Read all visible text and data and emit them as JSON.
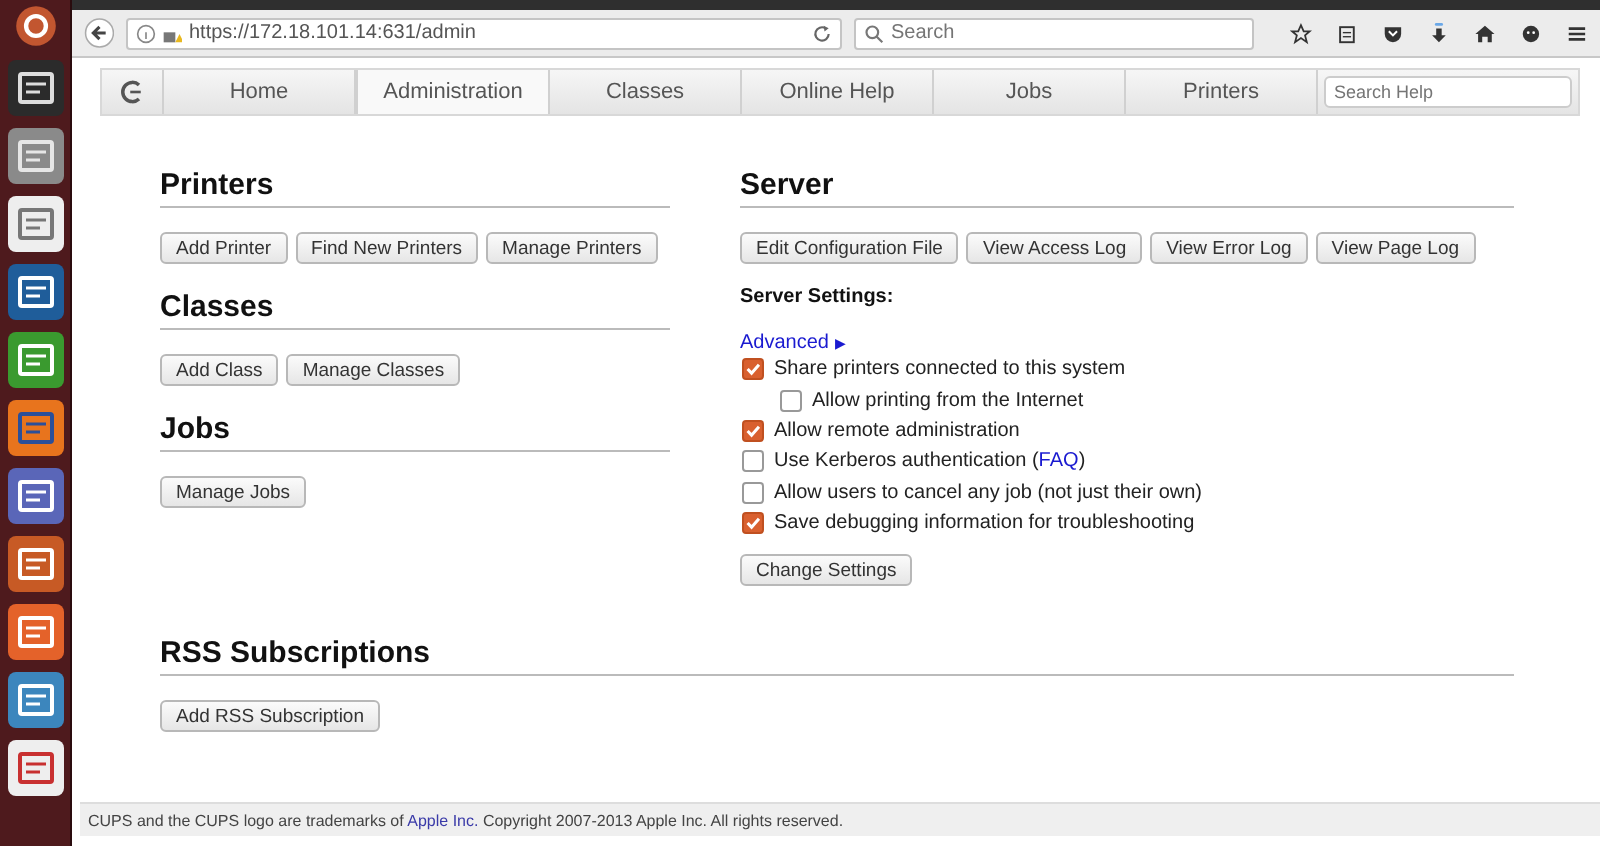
{
  "browser": {
    "url": "https://172.18.101.14:631/admin",
    "search": {
      "placeholder": "Search"
    }
  },
  "nav": {
    "tabs": [
      {
        "label": "Home",
        "selected": false
      },
      {
        "label": "Administration",
        "selected": true
      },
      {
        "label": "Classes",
        "selected": false
      },
      {
        "label": "Online Help",
        "selected": false
      },
      {
        "label": "Jobs",
        "selected": false
      },
      {
        "label": "Printers",
        "selected": false
      }
    ],
    "search": {
      "placeholder": "Search Help"
    }
  },
  "left_sections": [
    {
      "title": "Printers",
      "buttons": [
        "Add Printer",
        "Find New Printers",
        "Manage Printers"
      ]
    },
    {
      "title": "Classes",
      "buttons": [
        "Add Class",
        "Manage Classes"
      ]
    },
    {
      "title": "Jobs",
      "buttons": [
        "Manage Jobs"
      ]
    }
  ],
  "server": {
    "title": "Server",
    "buttons": [
      "Edit Configuration File",
      "View Access Log",
      "View Error Log",
      "View Page Log"
    ],
    "settings_label": "Server Settings:",
    "advanced": {
      "label": "Advanced",
      "arrow": "▶"
    },
    "settings": [
      {
        "label": "Share printers connected to this system",
        "checked": true,
        "children": [
          {
            "label": "Allow printing from the Internet",
            "checked": false
          }
        ]
      },
      {
        "label": "Allow remote administration",
        "checked": true
      },
      {
        "label": "Use Kerberos authentication (",
        "link": "FAQ",
        "label_end": ")",
        "checked": false
      },
      {
        "label": "Allow users to cancel any job (not just their own)",
        "checked": false
      },
      {
        "label": "Save debugging information for troubleshooting",
        "checked": true
      }
    ],
    "submit": "Change Settings"
  },
  "rss": {
    "title": "RSS Subscriptions",
    "buttons": [
      "Add RSS Subscription"
    ]
  },
  "footer": {
    "before": "CUPS and the CUPS logo are trademarks of ",
    "link": "Apple Inc.",
    "after": " Copyright 2007-2013 Apple Inc. All rights reserved."
  }
}
